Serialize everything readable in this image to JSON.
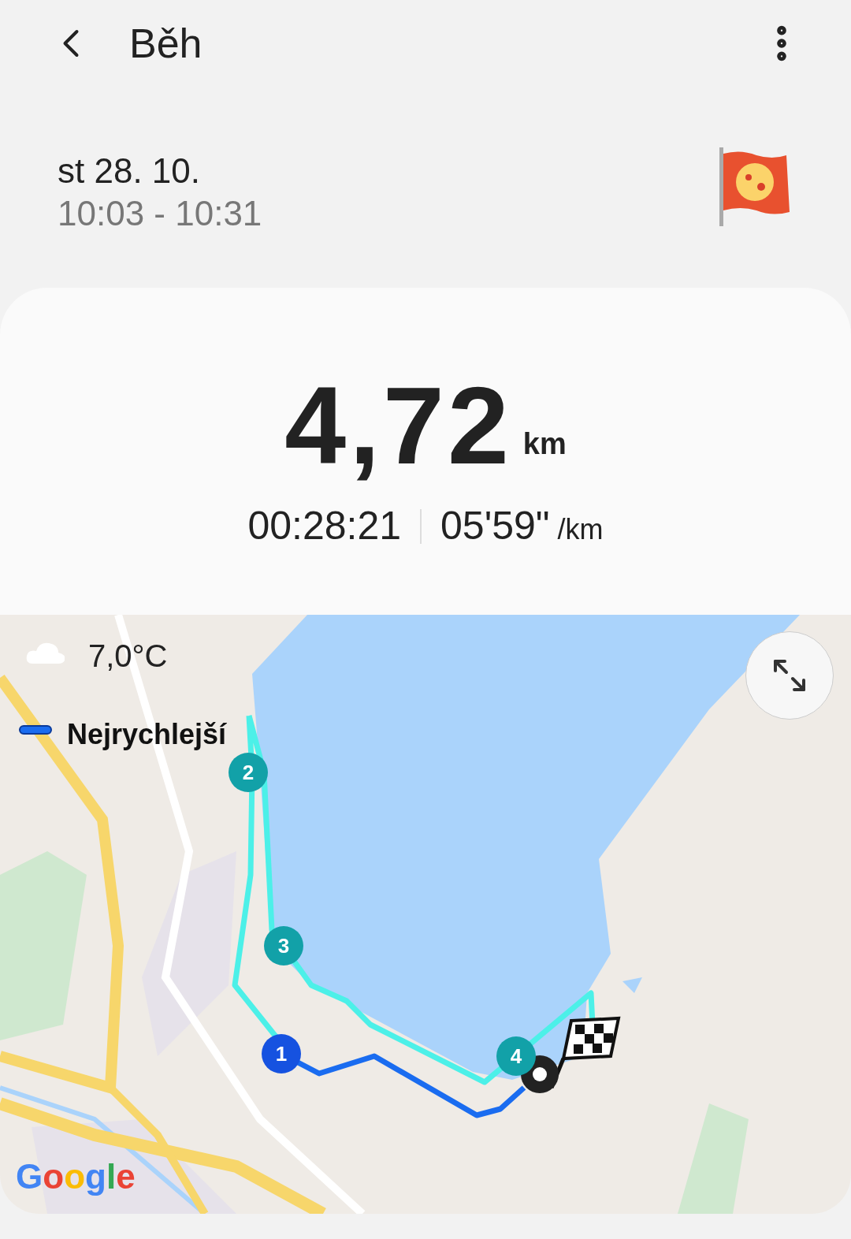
{
  "header": {
    "title": "Běh"
  },
  "session": {
    "date": "st 28. 10.",
    "time_range": "10:03 - 10:31"
  },
  "summary": {
    "distance": "4,72",
    "distance_unit": "km",
    "duration": "00:28:21",
    "pace": "05'59\"",
    "pace_unit": "/km"
  },
  "map": {
    "weather": "7,0°C",
    "legend": "Nejrychlejší",
    "markers": [
      {
        "label": "2",
        "color": "#12a1a8"
      },
      {
        "label": "3",
        "color": "#12a1a8"
      },
      {
        "label": "1",
        "color": "#1652e0"
      },
      {
        "label": "4",
        "color": "#12a1a8"
      }
    ],
    "attribution": "Google"
  }
}
